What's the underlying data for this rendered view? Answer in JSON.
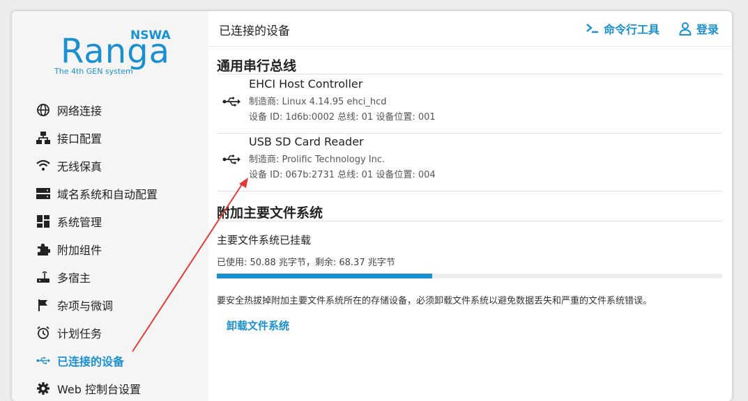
{
  "logo": {
    "main": "Ranga",
    "top": "NSWA",
    "sub": "The 4th GEN system"
  },
  "sidebar": {
    "items": [
      {
        "label": "网络连接",
        "icon": "globe-icon"
      },
      {
        "label": "接口配置",
        "icon": "network-icon"
      },
      {
        "label": "无线保真",
        "icon": "wifi-icon"
      },
      {
        "label": "域名系统和自动配置",
        "icon": "server-icon"
      },
      {
        "label": "系统管理",
        "icon": "dashboard-icon"
      },
      {
        "label": "附加组件",
        "icon": "puzzle-icon"
      },
      {
        "label": "多宿主",
        "icon": "router-icon"
      },
      {
        "label": "杂项与微调",
        "icon": "flag-icon"
      },
      {
        "label": "计划任务",
        "icon": "alarm-clock-icon"
      },
      {
        "label": "已连接的设备",
        "icon": "usb-icon",
        "active": true
      },
      {
        "label": "Web 控制台设置",
        "icon": "gear-icon"
      }
    ]
  },
  "header": {
    "title": "已连接的设备",
    "cli_label": "命令行工具",
    "login_label": "登录"
  },
  "usb_section": {
    "title": "通用串行总线",
    "devices": [
      {
        "name": "EHCI Host Controller",
        "manufacturer": "制造商: Linux 4.14.95 ehci_hcd",
        "info": "设备 ID: 1d6b:0002 总线: 01 设备位置: 001"
      },
      {
        "name": "USB SD Card Reader",
        "manufacturer": "制造商: Prolific Technology Inc.",
        "info": "设备 ID: 067b:2731 总线: 01 设备位置: 004"
      }
    ]
  },
  "storage_section": {
    "title": "附加主要文件系统",
    "status": "主要文件系统已挂载",
    "usage_text": "已使用: 50.88 兆字节，剩余: 68.37 兆字节",
    "usage_fraction": 0.4267,
    "note": "要安全热拔掉附加主要文件系统所在的存储设备，必须卸载文件系统以避免数据丢失和严重的文件系统错误。",
    "unmount_label": "卸载文件系统"
  },
  "colors": {
    "accent": "#1a8fd1",
    "annotation_arrow": "#e53935"
  }
}
